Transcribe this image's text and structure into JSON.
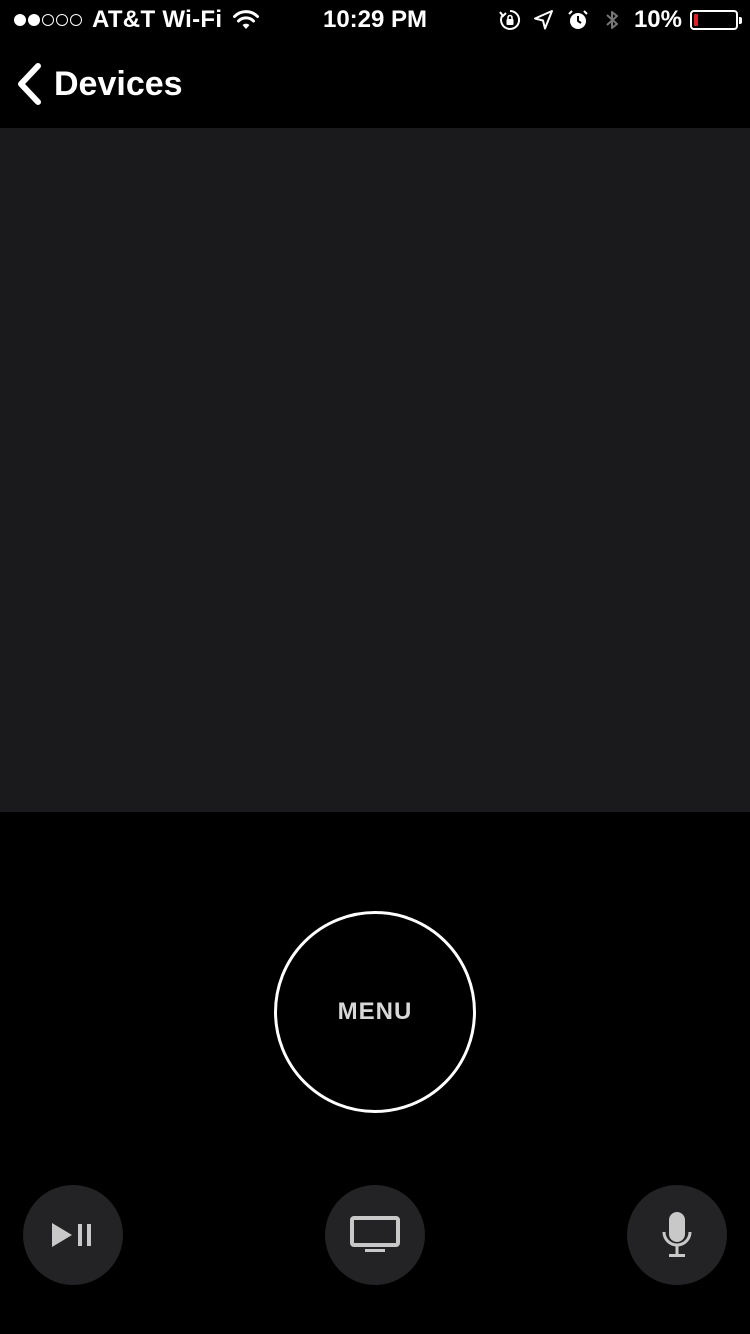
{
  "status_bar": {
    "carrier": "AT&T Wi-Fi",
    "time": "10:29 PM",
    "battery_percent": "10%",
    "battery_level": 0.1,
    "battery_color": "#e0202a",
    "signal_bars_filled": 2,
    "signal_bars_total": 5,
    "icons": [
      "wifi-icon",
      "rotation-lock-icon",
      "location-icon",
      "alarm-icon",
      "bluetooth-icon",
      "battery-icon"
    ]
  },
  "nav": {
    "back_label": "Devices",
    "back_icon": "chevron-left-icon"
  },
  "touch_surface": {
    "background": "#1a1a1c"
  },
  "controls": {
    "menu_label": "MENU",
    "play_pause_icon": "play-pause-icon",
    "tv_icon": "tv-icon",
    "mic_icon": "microphone-icon",
    "button_background": "#232325"
  }
}
